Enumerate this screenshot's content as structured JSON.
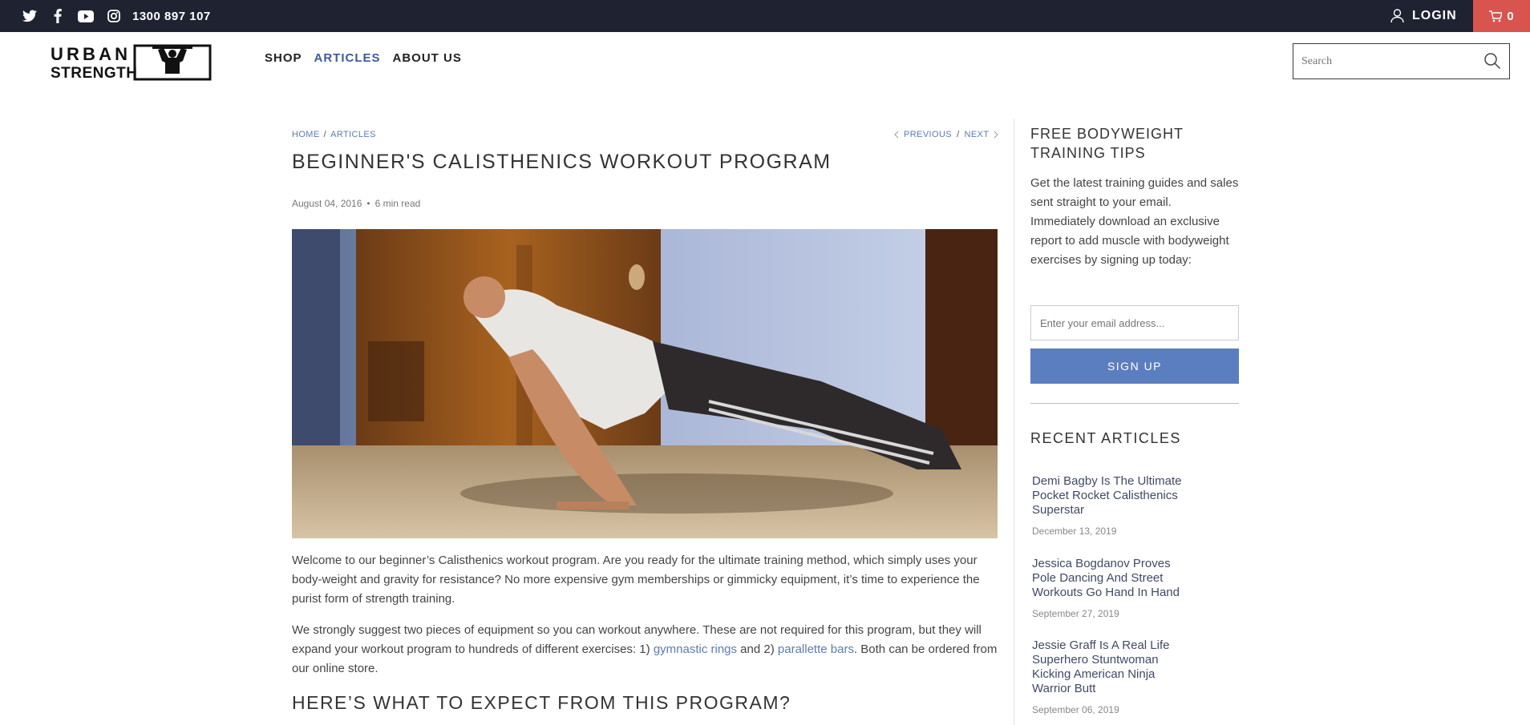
{
  "topbar": {
    "social_icons": [
      "twitter-icon",
      "facebook-icon",
      "youtube-icon",
      "instagram-icon"
    ],
    "phone": "1300 897 107",
    "login_label": "LOGIN",
    "cart_count": "0"
  },
  "header": {
    "logo_text_line1": "URBAN",
    "logo_text_line2": "STRENGTH",
    "nav": [
      {
        "label": "SHOP"
      },
      {
        "label": "ARTICLES"
      },
      {
        "label": "ABOUT US"
      }
    ],
    "search_placeholder": "Search"
  },
  "article": {
    "breadcrumb": {
      "home": "HOME",
      "articles": "ARTICLES"
    },
    "pager": {
      "previous": "PREVIOUS",
      "next": "NEXT"
    },
    "title": "BEGINNER'S CALISTHENICS WORKOUT PROGRAM",
    "date": "August 04, 2016",
    "read_time": "6 min read",
    "p1": "Welcome to our beginner’s Calisthenics workout program. Are you ready for the ultimate training method, which simply uses your body-weight and gravity for resistance? No more expensive gym memberships or gimmicky equipment, it’s time to experience the purist form of strength training.",
    "p2_before": "We strongly suggest two pieces of equipment so you can workout anywhere. These are not required for this program, but they will expand your workout program to hundreds of different exercises: 1) ",
    "p2_link1": "gymnastic rings",
    "p2_middle": " and 2) ",
    "p2_link2": "parallette bars",
    "p2_after": ". Both can be ordered from our online store.",
    "section_heading": "HERE’S WHAT TO EXPECT FROM THIS PROGRAM?"
  },
  "sidebar": {
    "newsletter_title": "FREE BODYWEIGHT TRAINING TIPS",
    "newsletter_text": "Get the latest training guides and sales sent straight to your email. Immediately download an exclusive report to add muscle with bodyweight exercises by signing up today:",
    "email_placeholder": "Enter your email address...",
    "signup_label": "SIGN UP",
    "recent_title": "RECENT ARTICLES",
    "recent": [
      {
        "title": "Demi Bagby Is The Ultimate Pocket Rocket Calisthenics Superstar",
        "date": "December 13, 2019"
      },
      {
        "title": "Jessica Bogdanov Proves Pole Dancing And Street Workouts Go Hand In Hand",
        "date": "September 27, 2019"
      },
      {
        "title": "Jessie Graff Is A Real Life Superhero Stuntwoman Kicking American Ninja Warrior Butt",
        "date": "September 06, 2019"
      }
    ]
  },
  "colors": {
    "topbar_bg": "#1f2230",
    "cart_bg": "#d9534f",
    "accent": "#5b7cb3",
    "button": "#5b7ec0"
  }
}
